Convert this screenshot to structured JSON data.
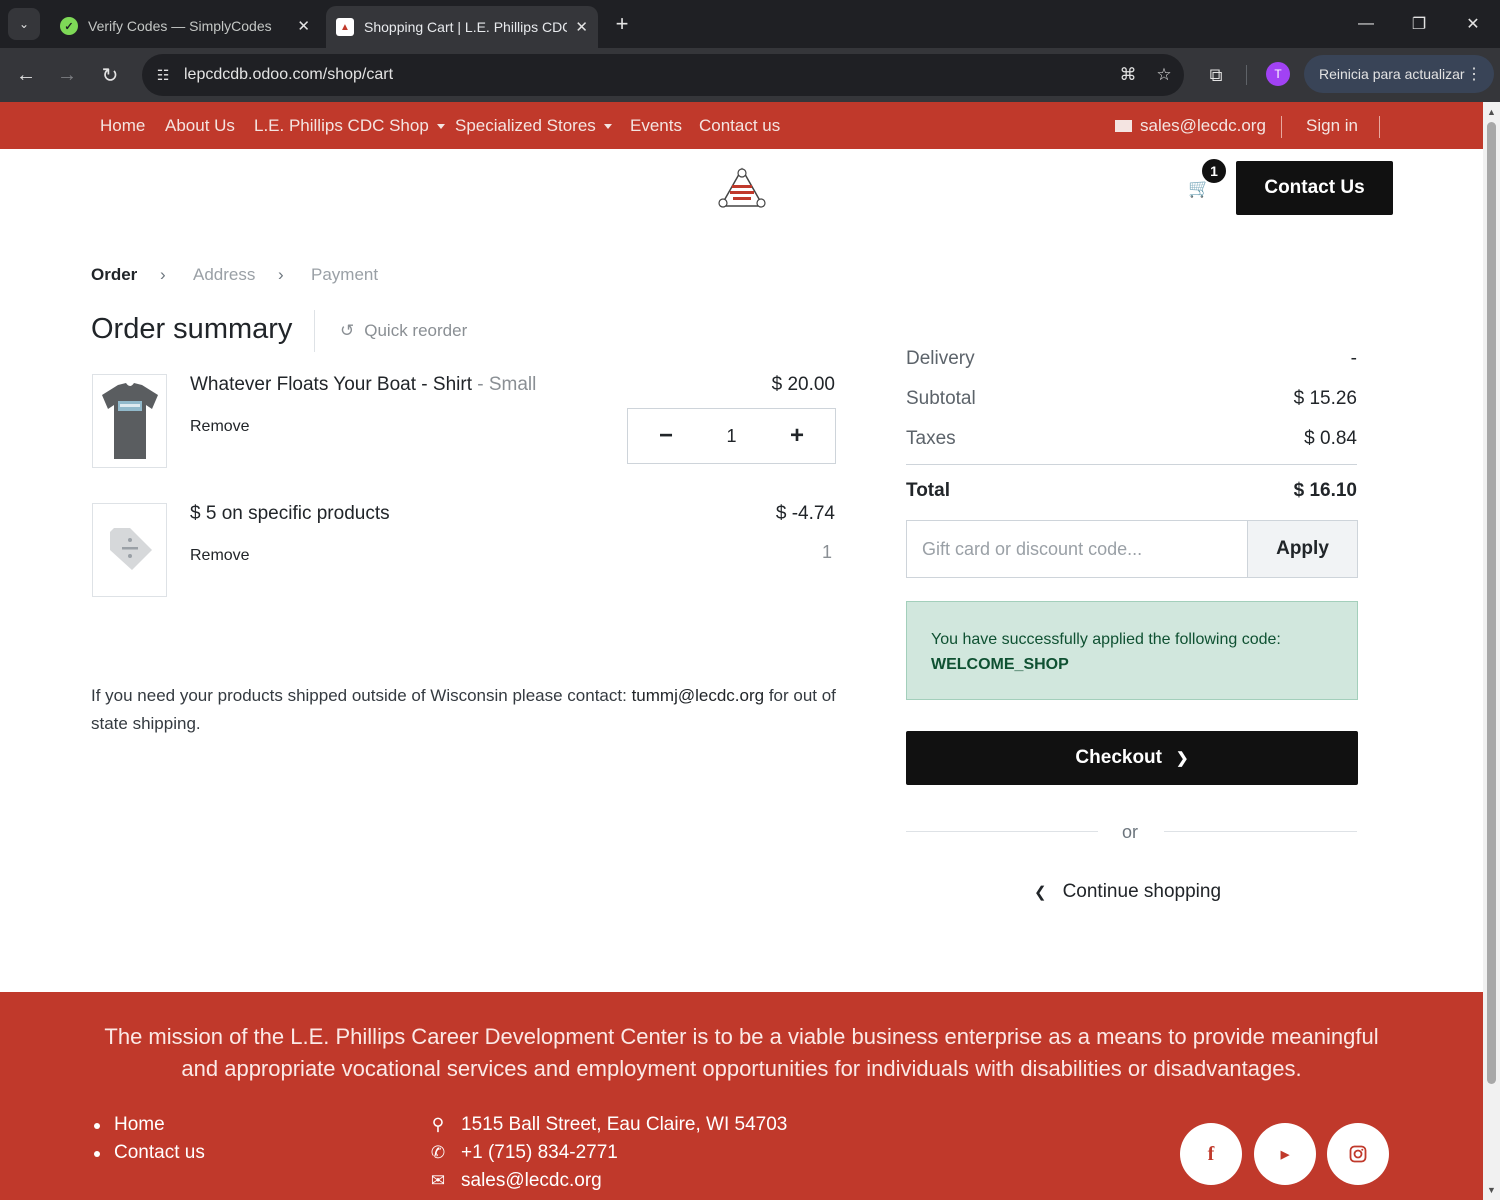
{
  "browser": {
    "tabs": [
      {
        "title": "Verify Codes — SimplyCodes",
        "close": "✕"
      },
      {
        "title": "Shopping Cart | L.E. Phillips CDC",
        "close": "✕"
      }
    ],
    "new_tab": "+",
    "url": "lepcdcdb.odoo.com/shop/cart",
    "avatar_letter": "T",
    "update_label": "Reinicia para actualizar"
  },
  "site_nav": {
    "items": [
      "Home",
      "About Us",
      "L.E. Phillips CDC Shop",
      "Specialized Stores",
      "Events",
      "Contact us"
    ],
    "email": "sales@lecdc.org",
    "signin": "Sign in"
  },
  "header": {
    "cart_count": "1",
    "contact_button": "Contact Us"
  },
  "steps": [
    "Order",
    "Address",
    "Payment"
  ],
  "order": {
    "title": "Order summary",
    "quick_reorder": "Quick reorder",
    "lines": [
      {
        "name": "Whatever Floats Your Boat - Shirt",
        "variant": "- Small",
        "remove": "Remove",
        "price": "$ 20.00",
        "quantity": "1"
      },
      {
        "name": "$ 5 on specific products",
        "remove": "Remove",
        "price": "$ -4.74",
        "quantity": "1"
      }
    ],
    "qty_minus": "−",
    "qty_plus": "+",
    "shipping_note_prefix": "If you need your products shipped outside of Wisconsin please contact:",
    "shipping_note_email": "tummj@lecdc.org",
    "shipping_note_suffix": "for out of state shipping."
  },
  "summary": {
    "delivery_label": "Delivery",
    "delivery_value": "-",
    "subtotal_label": "Subtotal",
    "subtotal_value": "$ 15.26",
    "taxes_label": "Taxes",
    "taxes_value": "$ 0.84",
    "total_label": "Total",
    "total_value": "$ 16.10",
    "promo_placeholder": "Gift card or discount code...",
    "apply_label": "Apply",
    "alert_text": "You have successfully applied the following code:",
    "alert_code": "WELCOME_SHOP",
    "checkout_label": "Checkout",
    "or_label": "or",
    "continue_label": "Continue shopping"
  },
  "footer": {
    "mission": "The mission of the L.E. Phillips Career Development Center is to be a viable business enterprise as a means to provide meaningful and appropriate vocational services and employment opportunities for individuals with disabilities or disadvantages.",
    "links": [
      "Home",
      "Contact us"
    ],
    "address": "1515 Ball Street, Eau Claire, WI 54703",
    "phone": "+1 (715) 834-2771",
    "email": "sales@lecdc.org"
  },
  "colors": {
    "brand_red": "#c0392b",
    "button_black": "#111111",
    "alert_green": "#d1e7dd"
  },
  "icons": [
    "chevron-down-icon",
    "back-icon",
    "forward-icon",
    "reload-icon",
    "site-info-icon",
    "translate-icon",
    "star-icon",
    "extensions-icon",
    "envelope-icon",
    "cart-icon",
    "refresh-icon",
    "tag-icon",
    "map-marker-icon",
    "phone-icon",
    "facebook-icon",
    "youtube-icon",
    "instagram-icon"
  ]
}
